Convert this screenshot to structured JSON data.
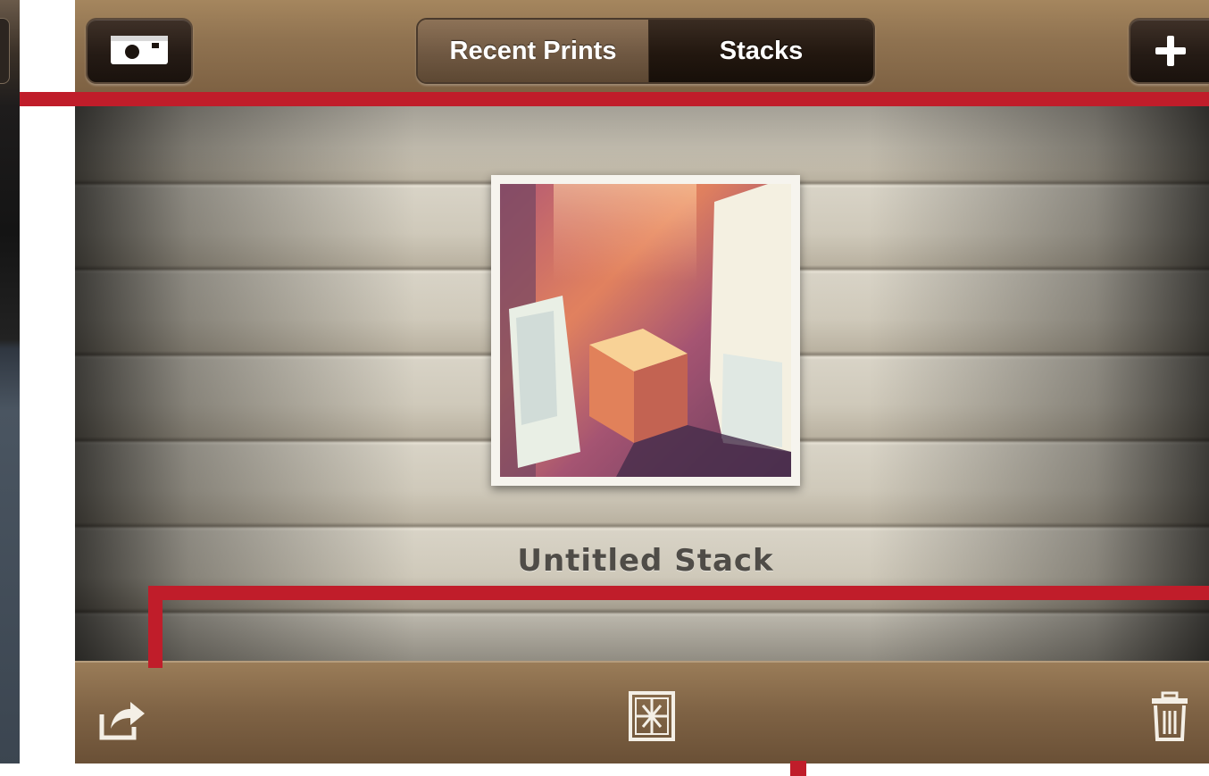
{
  "header": {
    "tabs": [
      {
        "label": "Recent Prints",
        "selected": false
      },
      {
        "label": "Stacks",
        "selected": true
      }
    ],
    "camera_icon": "camera-icon",
    "add_icon": "plus-icon"
  },
  "stack": {
    "title": "Untitled Stack"
  },
  "toolbar": {
    "share_icon": "share-icon",
    "gift_icon": "gift-icon",
    "trash_icon": "trash-icon"
  },
  "colors": {
    "wood_bar": "#8f7250",
    "callout_red": "#c01d2a",
    "title_text": "#4f4c47"
  }
}
